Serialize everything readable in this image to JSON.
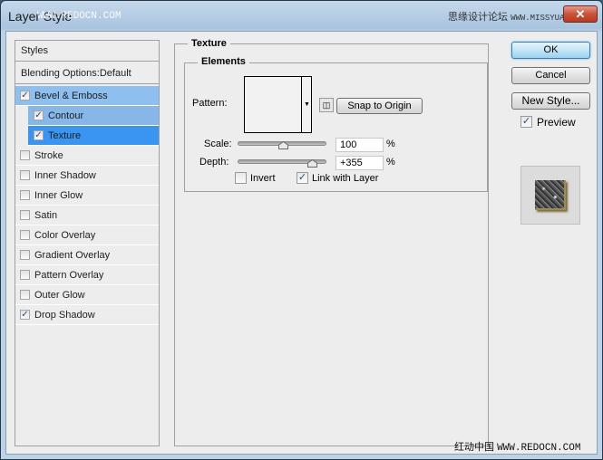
{
  "window": {
    "title": "Layer Style",
    "watermark_top_left": "WWW.REDOCN.COM",
    "watermark_top_right_cn": "思缘设计论坛",
    "watermark_top_right_url": "WWW.MISSYUAN.COM",
    "close_icon": "close-icon",
    "watermark_bottom_cn": "红动中国",
    "watermark_bottom_url": "WWW.REDOCN.COM"
  },
  "sidebar": {
    "header": "Styles",
    "blending": "Blending Options:Default",
    "items": [
      {
        "label": "Bevel & Emboss",
        "checked": true,
        "state": "selected-parent"
      },
      {
        "label": "Contour",
        "checked": true,
        "state": "sub"
      },
      {
        "label": "Texture",
        "checked": true,
        "state": "active-sub"
      },
      {
        "label": "Stroke",
        "checked": false
      },
      {
        "label": "Inner Shadow",
        "checked": false
      },
      {
        "label": "Inner Glow",
        "checked": false
      },
      {
        "label": "Satin",
        "checked": false
      },
      {
        "label": "Color Overlay",
        "checked": false
      },
      {
        "label": "Gradient Overlay",
        "checked": false
      },
      {
        "label": "Pattern Overlay",
        "checked": false
      },
      {
        "label": "Outer Glow",
        "checked": false
      },
      {
        "label": "Drop Shadow",
        "checked": true
      }
    ]
  },
  "texture": {
    "section_title": "Texture",
    "group_title": "Elements",
    "pattern_label": "Pattern:",
    "snap_button": "Snap to Origin",
    "scale_label": "Scale:",
    "scale_value": "100",
    "scale_unit": "%",
    "scale_slider_fraction": 0.5,
    "depth_label": "Depth:",
    "depth_value": "+355",
    "depth_unit": "%",
    "depth_slider_fraction": 0.83,
    "invert_label": "Invert",
    "invert_checked": false,
    "link_label": "Link with Layer",
    "link_checked": true
  },
  "actions": {
    "ok": "OK",
    "cancel": "Cancel",
    "new_style": "New Style...",
    "preview_label": "Preview",
    "preview_checked": true
  },
  "check_glyph": "✓"
}
